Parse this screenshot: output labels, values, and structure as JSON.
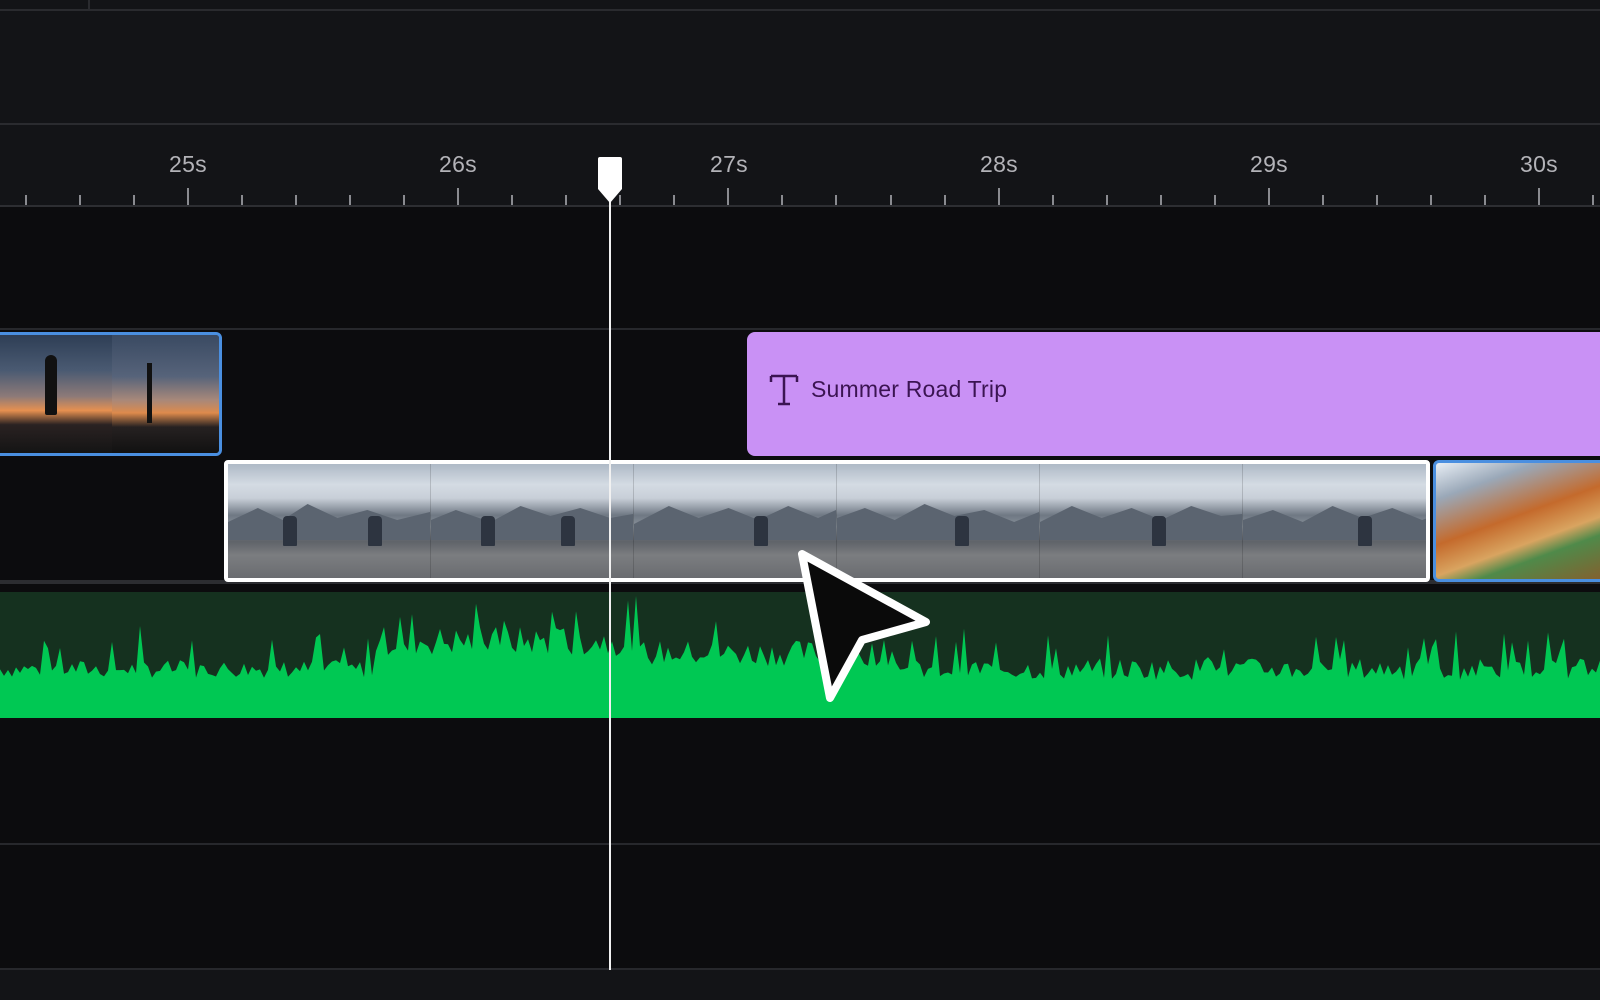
{
  "ruler": {
    "labels": [
      "25s",
      "26s",
      "27s",
      "28s",
      "29s",
      "30s"
    ]
  },
  "tracks": {
    "title_clip": {
      "label": "Summer Road Trip",
      "icon": "text-tool-icon",
      "color": "#c991f5"
    },
    "main_video_clip": {
      "selected": true,
      "border_color": "#ffffff"
    },
    "broll_clips": {
      "border_color": "#4a8fe0"
    },
    "audio": {
      "wave_color": "#00c853",
      "background": "#15311f"
    }
  },
  "playhead": {
    "time_label": "26.57s"
  },
  "colors": {
    "background": "#0c0c0e",
    "panel": "#131417",
    "selection": "#4a8fe0"
  }
}
